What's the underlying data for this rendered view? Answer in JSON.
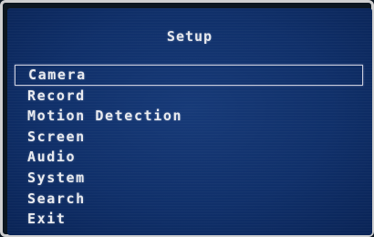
{
  "title": "Setup",
  "menu": {
    "items": [
      {
        "label": "Camera",
        "selected": true
      },
      {
        "label": "Record",
        "selected": false
      },
      {
        "label": "Motion Detection",
        "selected": false
      },
      {
        "label": "Screen",
        "selected": false
      },
      {
        "label": "Audio",
        "selected": false
      },
      {
        "label": "System",
        "selected": false
      },
      {
        "label": "Search",
        "selected": false
      },
      {
        "label": "Exit",
        "selected": false
      }
    ]
  },
  "colors": {
    "background": "#10306a",
    "text": "#e9ebf0",
    "selection_border": "#c9ccdc"
  }
}
